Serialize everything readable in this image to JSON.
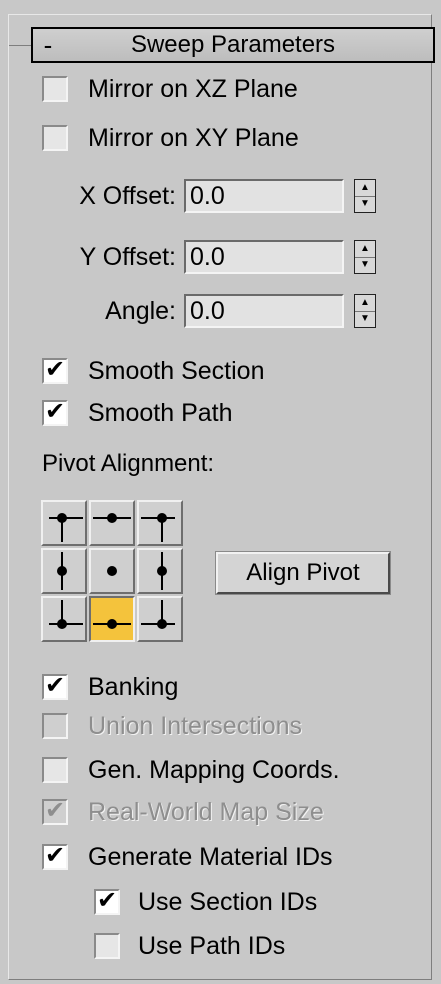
{
  "rollout": {
    "toggle": "-",
    "title": "Sweep Parameters"
  },
  "mirror": {
    "xz": {
      "label": "Mirror on XZ Plane",
      "checked": false
    },
    "xy": {
      "label": "Mirror on XY Plane",
      "checked": false
    }
  },
  "offsets": {
    "x": {
      "label": "X Offset:",
      "value": "0.0"
    },
    "y": {
      "label": "Y Offset:",
      "value": "0.0"
    },
    "angle": {
      "label": "Angle:",
      "value": "0.0"
    }
  },
  "smooth": {
    "section": {
      "label": "Smooth Section",
      "checked": true
    },
    "path": {
      "label": "Smooth Path",
      "checked": true
    }
  },
  "pivot": {
    "label": "Pivot Alignment:",
    "selected": "bottom-center",
    "align_button": "Align Pivot"
  },
  "options": {
    "banking": {
      "label": "Banking",
      "checked": true,
      "enabled": true
    },
    "union": {
      "label": "Union Intersections",
      "checked": false,
      "enabled": false
    },
    "gen_mapping": {
      "label": "Gen. Mapping Coords.",
      "checked": false,
      "enabled": true
    },
    "real_world": {
      "label": "Real-World Map Size",
      "checked": true,
      "enabled": false
    },
    "material_ids": {
      "label": "Generate Material IDs",
      "checked": true,
      "enabled": true
    },
    "section_ids": {
      "label": "Use Section IDs",
      "checked": true,
      "enabled": true
    },
    "path_ids": {
      "label": "Use Path IDs",
      "checked": false,
      "enabled": true
    }
  },
  "colors": {
    "panel_bg": "#c8c8c8",
    "pivot_active": "#f4c33c",
    "disabled_text": "#8e8e8e"
  }
}
